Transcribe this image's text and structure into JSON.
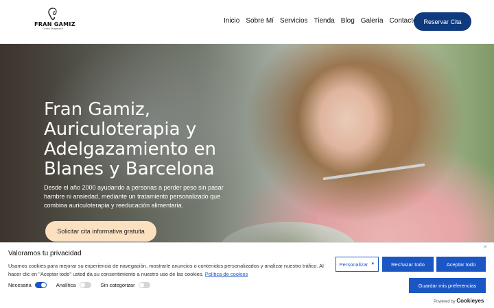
{
  "header": {
    "logo": {
      "name": "FRAN GAMIZ",
      "subtitle": "Centro Terapéutico"
    },
    "nav": [
      {
        "label": "Inicio"
      },
      {
        "label": "Sobre Mí"
      },
      {
        "label": "Servicios"
      },
      {
        "label": "Tienda"
      },
      {
        "label": "Blog"
      },
      {
        "label": "Galería"
      },
      {
        "label": "Contacto"
      }
    ],
    "cta_label": "Reservar Cita"
  },
  "hero": {
    "title": "Fran Gamiz, Auriculoterapia y Adelgazamiento en Blanes y Barcelona",
    "description": "Desde el año 2000 ayudando a personas a perder peso sin pasar hambre ni ansiedad, mediante un tratamiento personalizado que combina auriculoterapia y reeducación alimentaria.",
    "cta_label": "Solicitar cita informativa gratuita"
  },
  "cookie_banner": {
    "title": "Valoramos tu privacidad",
    "text": "Usamos cookies para mejorar su experiencia de navegación, mostrarle anuncios o contenidos personalizados y analizar nuestro tráfico. Al hacer clic en \"Aceptar todo\" usted da su consentimiento a nuestro uso de las cookies.",
    "policy_link": "Política de cookies",
    "close_label": "×",
    "toggles": [
      {
        "label": "Necesaria",
        "on": true
      },
      {
        "label": "Analítica",
        "on": false
      },
      {
        "label": "Sin categorizar",
        "on": false
      }
    ],
    "buttons": {
      "customize": "Personalizar",
      "reject": "Rechazar todo",
      "accept": "Aceptar todo",
      "save": "Guardar mis preferencias"
    },
    "powered_prefix": "Powered by",
    "powered_brand": "Cookieyes"
  },
  "colors": {
    "primary_blue": "#0f3a7d",
    "cookie_blue": "#1a57c4",
    "cta_peach": "#fbe1c0"
  }
}
